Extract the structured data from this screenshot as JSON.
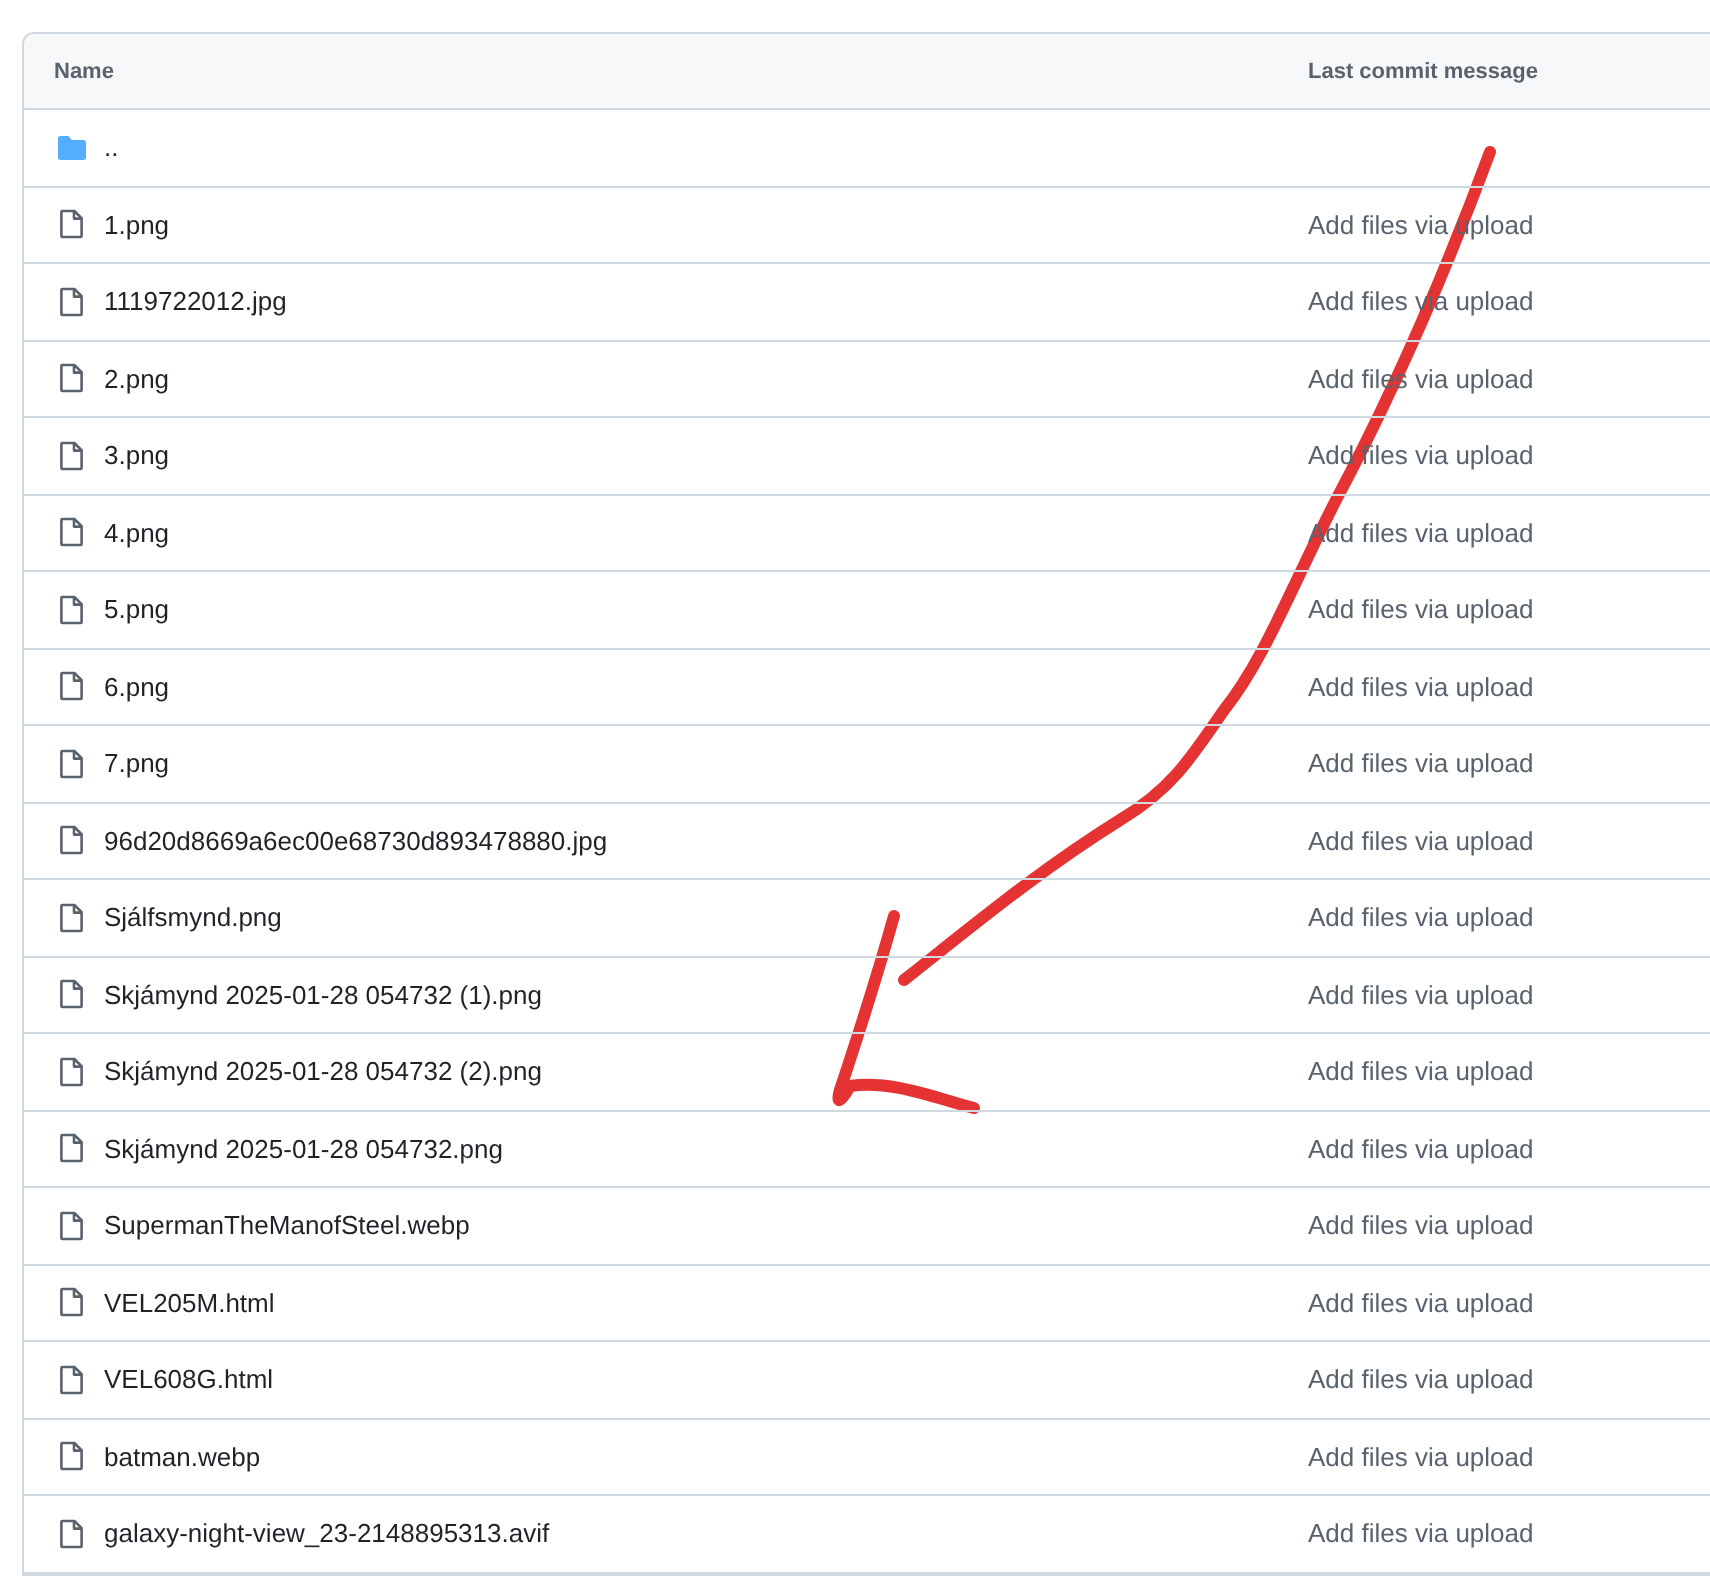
{
  "table": {
    "columns": [
      "Name",
      "Last commit message"
    ],
    "rows": [
      {
        "kind": "folder",
        "name": ".."
      },
      {
        "kind": "file",
        "name": "1.png",
        "message": "Add files via upload"
      },
      {
        "kind": "file",
        "name": "1119722012.jpg",
        "message": "Add files via upload"
      },
      {
        "kind": "file",
        "name": "2.png",
        "message": "Add files via upload"
      },
      {
        "kind": "file",
        "name": "3.png",
        "message": "Add files via upload"
      },
      {
        "kind": "file",
        "name": "4.png",
        "message": "Add files via upload"
      },
      {
        "kind": "file",
        "name": "5.png",
        "message": "Add files via upload"
      },
      {
        "kind": "file",
        "name": "6.png",
        "message": "Add files via upload"
      },
      {
        "kind": "file",
        "name": "7.png",
        "message": "Add files via upload"
      },
      {
        "kind": "file",
        "name": "96d20d8669a6ec00e68730d893478880.jpg",
        "message": "Add files via upload"
      },
      {
        "kind": "file",
        "name": "Sjálfsmynd.png",
        "message": "Add files via upload"
      },
      {
        "kind": "file",
        "name": "Skjámynd 2025-01-28 054732 (1).png",
        "message": "Add files via upload"
      },
      {
        "kind": "file",
        "name": "Skjámynd 2025-01-28 054732 (2).png",
        "message": "Add files via upload"
      },
      {
        "kind": "file",
        "name": "Skjámynd 2025-01-28 054732.png",
        "message": "Add files via upload"
      },
      {
        "kind": "file",
        "name": "SupermanTheManofSteel.webp",
        "message": "Add files via upload"
      },
      {
        "kind": "file",
        "name": "VEL205M.html",
        "message": "Add files via upload"
      },
      {
        "kind": "file",
        "name": "VEL608G.html",
        "message": "Add files via upload"
      },
      {
        "kind": "file",
        "name": "batman.webp",
        "message": "Add files via upload"
      },
      {
        "kind": "file",
        "name": "galaxy-night-view_23-2148895313.avif",
        "message": "Add files via upload"
      }
    ]
  }
}
